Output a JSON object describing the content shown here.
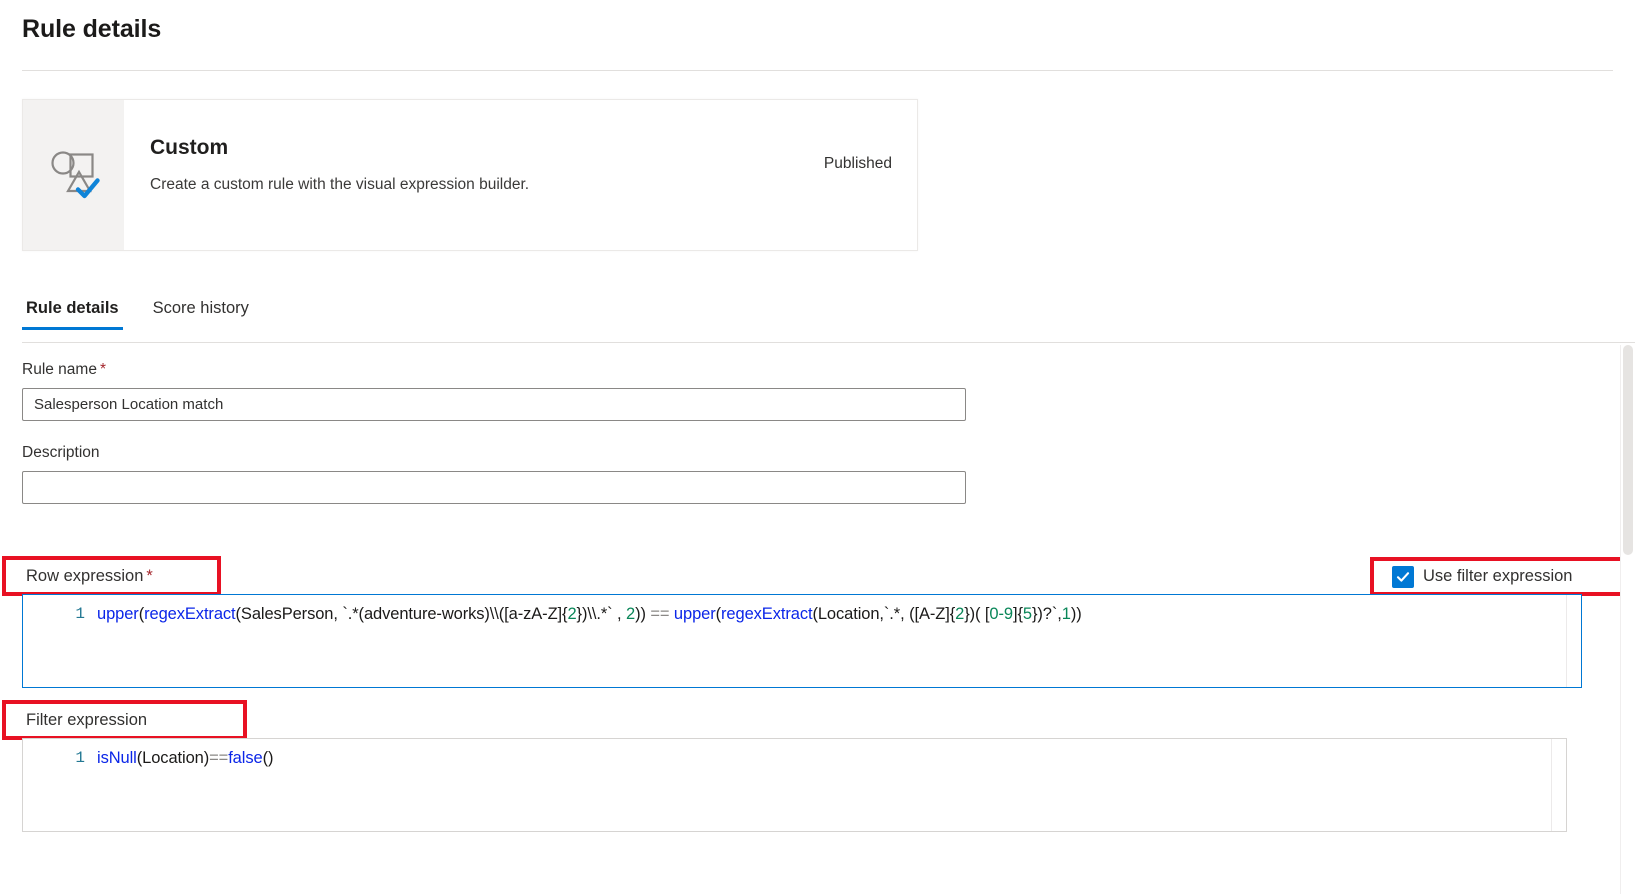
{
  "header": {
    "title": "Rule details"
  },
  "rule_type_card": {
    "icon": "shapes-check-icon",
    "title": "Custom",
    "description": "Create a custom rule with the visual expression builder.",
    "status": "Published"
  },
  "tabs": [
    {
      "label": "Rule details",
      "active": true
    },
    {
      "label": "Score history",
      "active": false
    }
  ],
  "form": {
    "rule_name": {
      "label": "Rule name",
      "required_marker": "*",
      "value": "Salesperson Location match",
      "placeholder": ""
    },
    "description": {
      "label": "Description",
      "value": "",
      "placeholder": ""
    },
    "row_expression": {
      "label": "Row expression",
      "required_marker": "*",
      "line_number": "1",
      "code": "upper(regexExtract(SalesPerson, `.*(adventure-works)\\\\([a-zA-Z]{2})\\\\.*` , 2)) == upper(regexExtract(Location,`.*, ([A-Z]{2})( [0-9]{5})?`,1))",
      "tokens": [
        {
          "text": "upper",
          "type": "fn"
        },
        {
          "text": "(",
          "type": "plain"
        },
        {
          "text": "regexExtract",
          "type": "fn"
        },
        {
          "text": "(SalesPerson, `.*(adventure-works)\\\\([a-zA-Z]",
          "type": "plain"
        },
        {
          "text": "{",
          "type": "plain"
        },
        {
          "text": "2",
          "type": "num"
        },
        {
          "text": "}",
          "type": "plain"
        },
        {
          "text": ")\\\\.*` , ",
          "type": "plain"
        },
        {
          "text": "2",
          "type": "num"
        },
        {
          "text": ")) ",
          "type": "plain"
        },
        {
          "text": "==",
          "type": "op"
        },
        {
          "text": " ",
          "type": "plain"
        },
        {
          "text": "upper",
          "type": "fn"
        },
        {
          "text": "(",
          "type": "plain"
        },
        {
          "text": "regexExtract",
          "type": "fn"
        },
        {
          "text": "(Location,`.*, ([A-Z]",
          "type": "plain"
        },
        {
          "text": "{",
          "type": "plain"
        },
        {
          "text": "2",
          "type": "num"
        },
        {
          "text": "}",
          "type": "plain"
        },
        {
          "text": ")( [",
          "type": "plain"
        },
        {
          "text": "0-9",
          "type": "num"
        },
        {
          "text": "]",
          "type": "plain"
        },
        {
          "text": "{",
          "type": "plain"
        },
        {
          "text": "5",
          "type": "num"
        },
        {
          "text": "}",
          "type": "plain"
        },
        {
          "text": ")?`,",
          "type": "plain"
        },
        {
          "text": "1",
          "type": "num"
        },
        {
          "text": "))",
          "type": "plain"
        }
      ]
    },
    "use_filter_expression": {
      "label": "Use filter expression",
      "checked": true
    },
    "filter_expression": {
      "label": "Filter expression",
      "line_number": "1",
      "code": "isNull(Location)==false()",
      "tokens": [
        {
          "text": "isNull",
          "type": "fn"
        },
        {
          "text": "(Location)",
          "type": "plain"
        },
        {
          "text": "==",
          "type": "op"
        },
        {
          "text": "false",
          "type": "fn"
        },
        {
          "text": "()",
          "type": "plain"
        }
      ]
    }
  },
  "colors": {
    "accent": "#0078d4",
    "annotation": "#e81123",
    "required": "#a4262c",
    "code_function": "#0b26e8",
    "code_number": "#098658",
    "code_operator": "#8a8886",
    "card_icon_pane": "#f3f2f1"
  }
}
